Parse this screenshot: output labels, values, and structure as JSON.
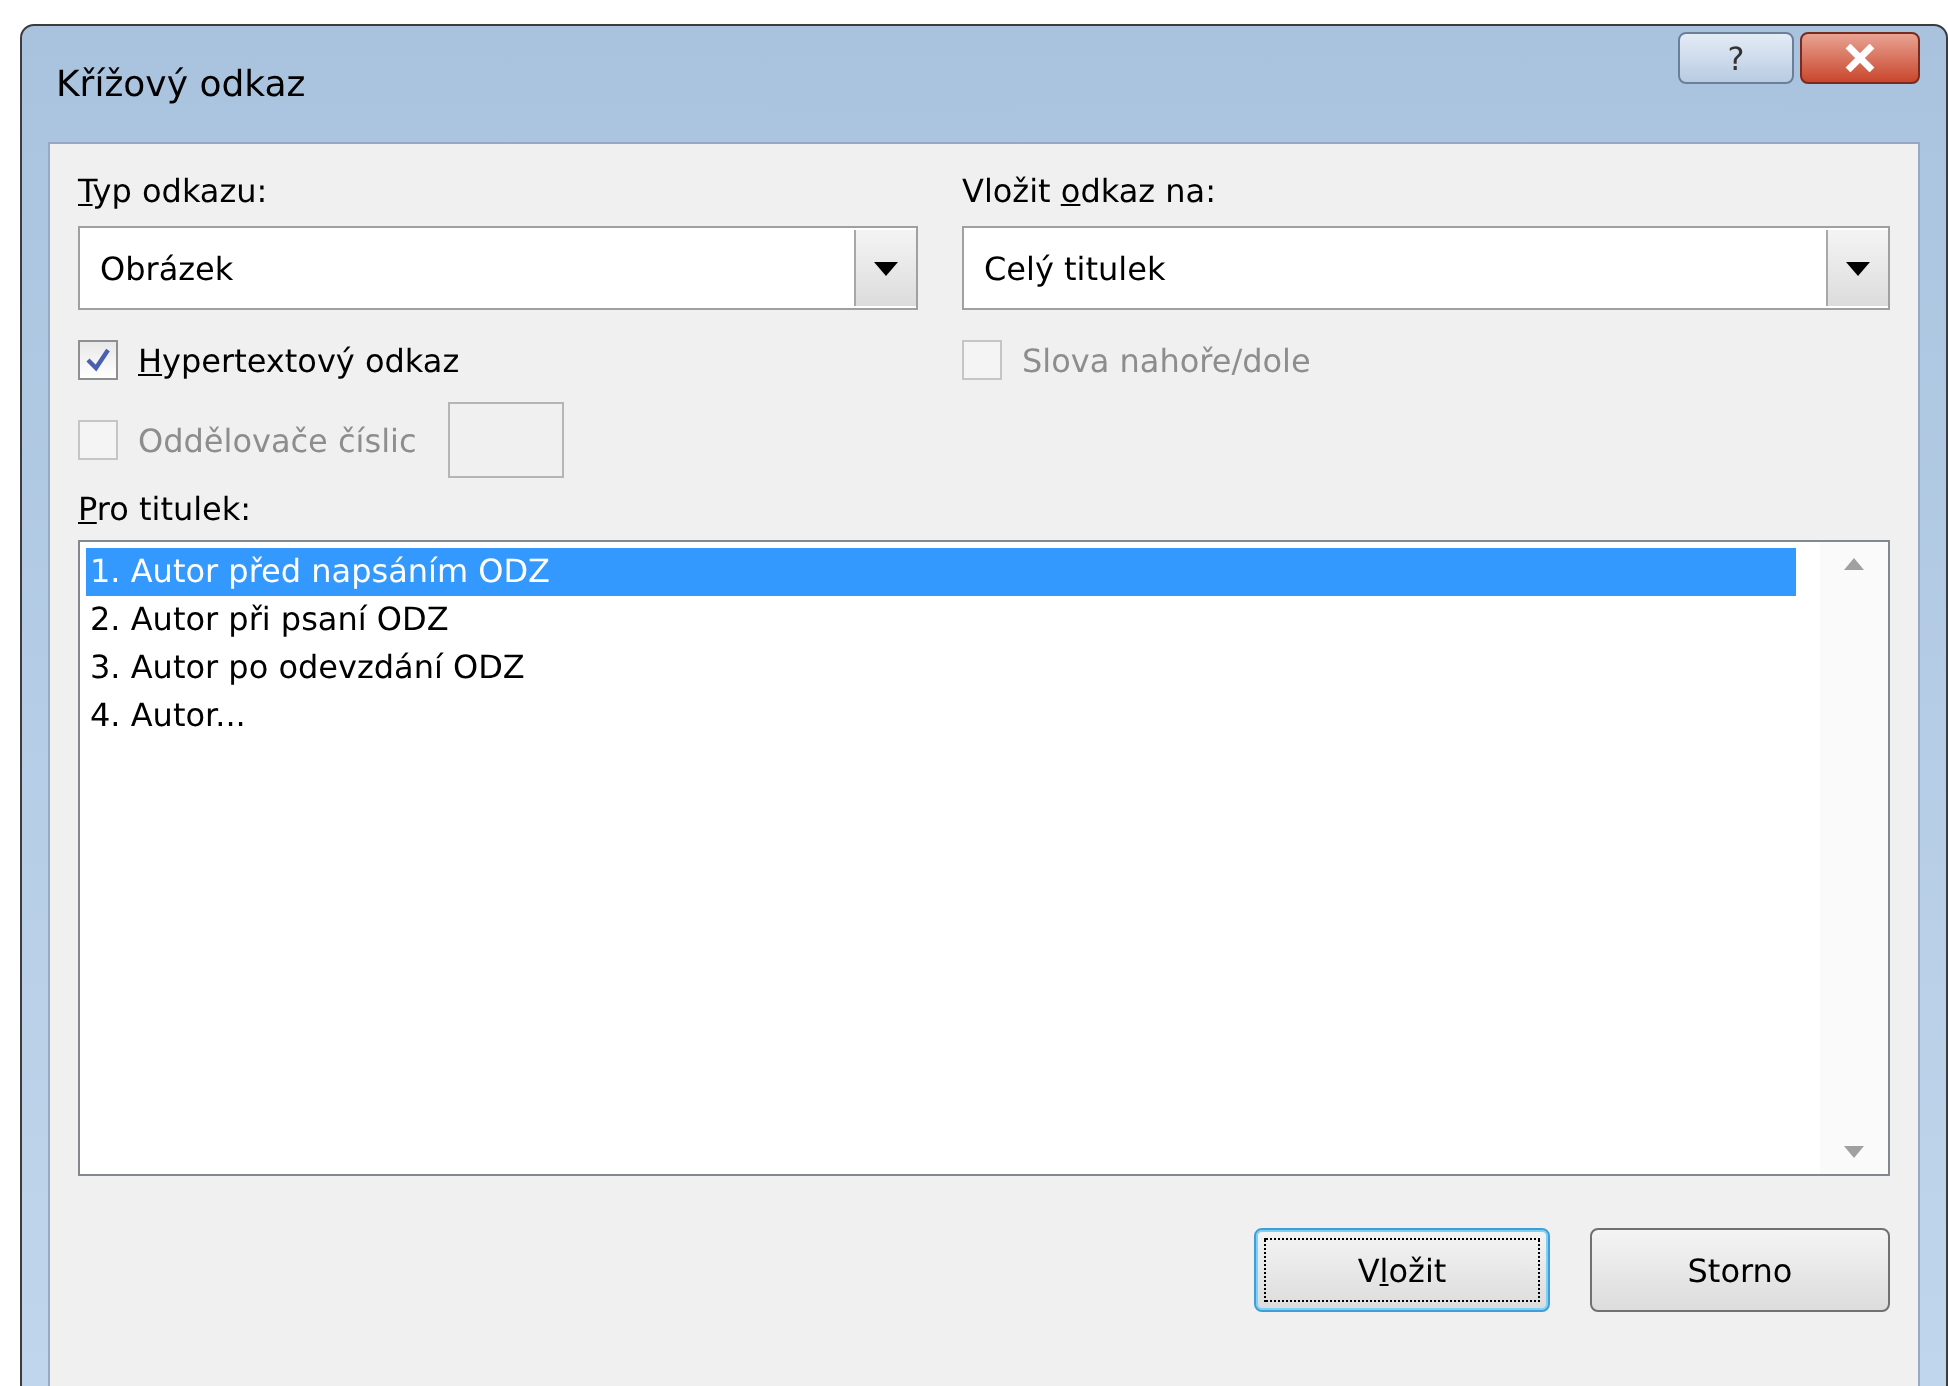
{
  "window": {
    "title": "Křížový odkaz",
    "help_button": "?"
  },
  "reference_type": {
    "label": {
      "key": "T",
      "post": "yp odkazu:"
    },
    "value": "Obrázek"
  },
  "insert_reference_to": {
    "label": {
      "pre": "Vložit ",
      "key": "o",
      "post": "dkaz na:"
    },
    "value": "Celý titulek"
  },
  "checkboxes": [
    {
      "label": {
        "key": "H",
        "post": "ypertextový odkaz"
      },
      "checked": true,
      "disabled": false
    },
    {
      "label": {
        "pre": "Slova nahoře/dole"
      },
      "checked": false,
      "disabled": true
    },
    {
      "label": {
        "pre": "Oddělovače číslic"
      },
      "checked": false,
      "disabled": true
    }
  ],
  "for_caption": {
    "label": {
      "key": "P",
      "post": "ro titulek:"
    },
    "items": [
      {
        "text": "1. Autor před napsáním ODZ",
        "selected": true
      },
      {
        "text": "2. Autor při psaní ODZ",
        "selected": false
      },
      {
        "text": "3. Autor po odevzdání ODZ",
        "selected": false
      },
      {
        "text": "4. Autor...",
        "selected": false
      }
    ]
  },
  "buttons": [
    {
      "label": {
        "pre": "V",
        "key": "l",
        "post": "ožit"
      },
      "default": true
    },
    {
      "label": {
        "pre": "Storno"
      },
      "default": false
    }
  ]
}
